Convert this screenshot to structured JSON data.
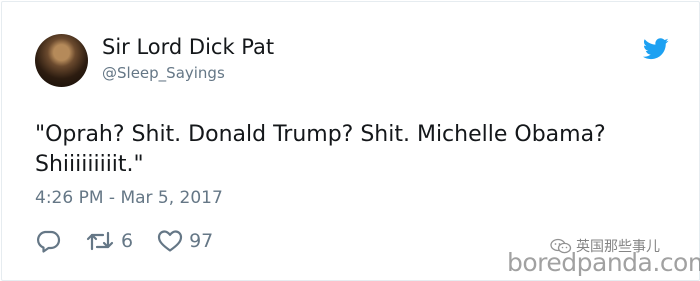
{
  "tweet": {
    "display_name": "Sir Lord Dick Pat",
    "handle": "@Sleep_Sayings",
    "text": "\"Oprah? Shit. Donald Trump? Shit. Michelle Obama? Shiiiiiiiiit.\"",
    "timestamp": "4:26 PM - Mar 5, 2017",
    "retweet_count": "6",
    "like_count": "97",
    "brand_color": "#1da1f2",
    "icons": {
      "reply": "reply-icon",
      "retweet": "retweet-icon",
      "like": "heart-icon",
      "brand": "twitter-bird-icon"
    }
  },
  "watermarks": {
    "channel": "英国那些事儿",
    "site": "boredpanda.com"
  }
}
